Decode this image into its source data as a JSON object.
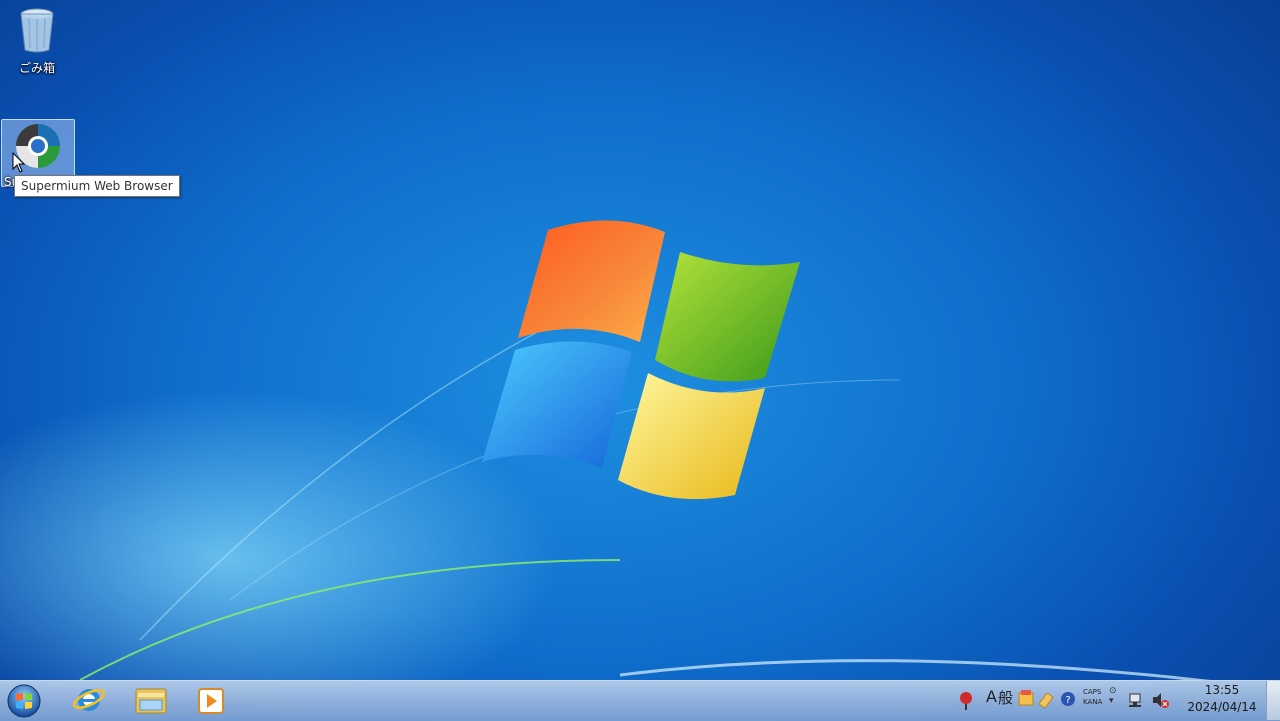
{
  "desktop": {
    "icons": [
      {
        "label": "ごみ箱",
        "icon": "recycle-bin-icon"
      },
      {
        "label": "Su",
        "icon": "supermium-browser-icon"
      }
    ],
    "tooltip": "Supermium Web Browser"
  },
  "taskbar": {
    "start_icon": "windows-start-orb-icon",
    "pinned": [
      "internet-explorer-icon",
      "windows-explorer-icon",
      "media-player-icon"
    ]
  },
  "tray": {
    "ime_a": "A",
    "ime_mode": "般",
    "caps": "CAPS",
    "kana": "KANA",
    "time": "13:55",
    "date": "2024/04/14"
  },
  "colors": {
    "desktop_blue": "#0f6fcc",
    "taskbar": "#9fb9dc"
  }
}
